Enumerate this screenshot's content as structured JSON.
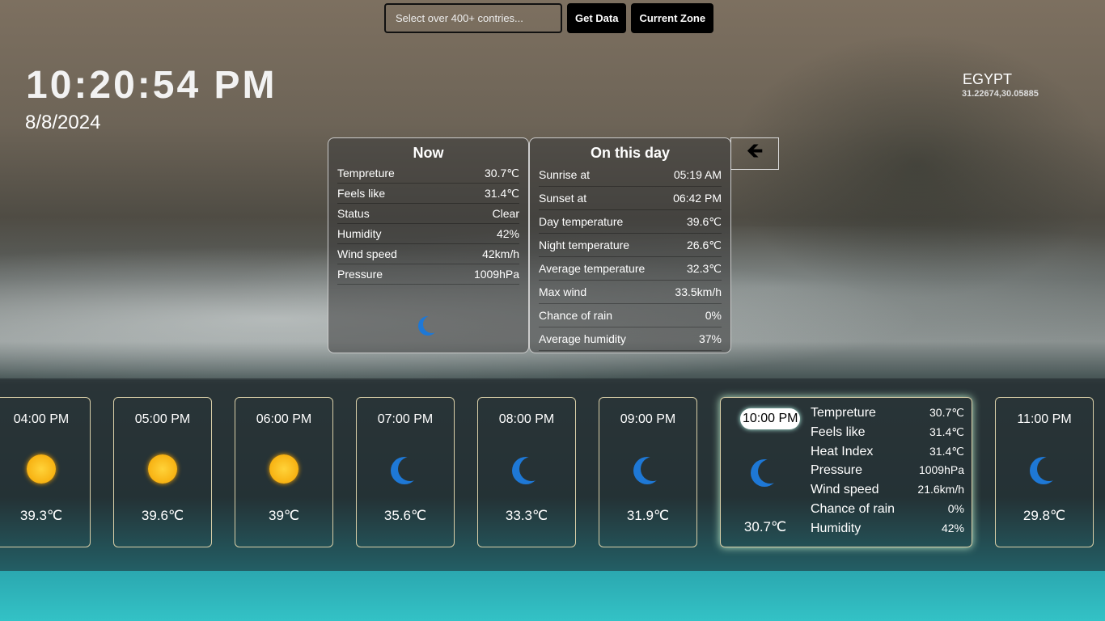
{
  "search": {
    "placeholder": "Select over 400+ contries...",
    "get_data": "Get Data",
    "current_zone": "Current Zone"
  },
  "clock": {
    "time": "10:20:54 PM",
    "date": "8/8/2024"
  },
  "location": {
    "country": "EGYPT",
    "coords": "31.22674,30.05885"
  },
  "now": {
    "title": "Now",
    "rows": [
      [
        "Tempreture",
        "30.7℃"
      ],
      [
        "Feels like",
        "31.4℃"
      ],
      [
        "Status",
        "Clear"
      ],
      [
        "Humidity",
        "42%"
      ],
      [
        "Wind speed",
        "42km/h"
      ],
      [
        "Pressure",
        "1009hPa"
      ]
    ],
    "icon": "moon-icon"
  },
  "day": {
    "title": "On this day",
    "rows": [
      [
        "Sunrise at",
        "05:19 AM"
      ],
      [
        "Sunset at",
        "06:42 PM"
      ],
      [
        "Day temperature",
        "39.6℃"
      ],
      [
        "Night temperature",
        "26.6℃"
      ],
      [
        "Average temperature",
        "32.3℃"
      ],
      [
        "Max wind",
        "33.5km/h"
      ],
      [
        "Chance of rain",
        "0%"
      ],
      [
        "Average humidity",
        "37%"
      ]
    ]
  },
  "toggle": {
    "icon": "arrow-left-icon",
    "glyph": "🡸"
  },
  "hours": [
    {
      "time": "04:00 PM",
      "icon": "sun",
      "temp": "39.3℃"
    },
    {
      "time": "05:00 PM",
      "icon": "sun",
      "temp": "39.6℃"
    },
    {
      "time": "06:00 PM",
      "icon": "sun",
      "temp": "39℃"
    },
    {
      "time": "07:00 PM",
      "icon": "moon",
      "temp": "35.6℃"
    },
    {
      "time": "08:00 PM",
      "icon": "moon",
      "temp": "33.3℃"
    },
    {
      "time": "09:00 PM",
      "icon": "moon",
      "temp": "31.9℃"
    },
    {
      "time": "11:00 PM",
      "icon": "moon",
      "temp": "29.8℃"
    }
  ],
  "selected": {
    "time": "10:00 PM",
    "icon": "moon",
    "temp": "30.7℃",
    "rows": [
      [
        "Tempreture",
        "30.7℃"
      ],
      [
        "Feels like",
        "31.4℃"
      ],
      [
        "Heat Index",
        "31.4℃"
      ],
      [
        "Pressure",
        "1009hPa"
      ],
      [
        "Wind speed",
        "21.6km/h"
      ],
      [
        "Chance of rain",
        "0%"
      ],
      [
        "Humidity",
        "42%"
      ]
    ]
  }
}
